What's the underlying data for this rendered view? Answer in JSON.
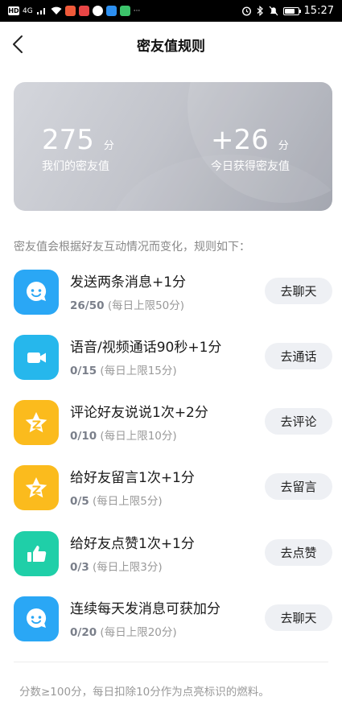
{
  "status_bar": {
    "left_chips": [
      "HD",
      "4G"
    ],
    "dots": "···",
    "time": "15:27",
    "battery_level": 0.75
  },
  "header": {
    "title": "密友值规则"
  },
  "card": {
    "score": "275",
    "score_unit": "分",
    "score_label": "我们的密友值",
    "today": "+26",
    "today_unit": "分",
    "today_label": "今日获得密友值"
  },
  "intro": "密友值会根据好友互动情况而变化，规则如下：",
  "rules": [
    {
      "title": "发送两条消息+1分",
      "progress": "26/50",
      "limit": "(每日上限50分)",
      "button": "去聊天",
      "icon": "chat-bubble-icon",
      "color": "#2aa7f5"
    },
    {
      "title": "语音/视频通话90秒+1分",
      "progress": "0/15",
      "limit": "(每日上限15分)",
      "button": "去通话",
      "icon": "video-camera-icon",
      "color": "#26b7ec"
    },
    {
      "title": "评论好友说说1次+2分",
      "progress": "0/10",
      "limit": "(每日上限10分)",
      "button": "去评论",
      "icon": "star-icon",
      "color": "#fbbb1d"
    },
    {
      "title": "给好友留言1次+1分",
      "progress": "0/5",
      "limit": "(每日上限5分)",
      "button": "去留言",
      "icon": "star-icon",
      "color": "#fbbb1d"
    },
    {
      "title": "给好友点赞1次+1分",
      "progress": "0/3",
      "limit": "(每日上限3分)",
      "button": "去点赞",
      "icon": "thumbs-up-icon",
      "color": "#1fcfa8"
    },
    {
      "title": "连续每天发消息可获加分",
      "progress": "0/20",
      "limit": "(每日上限20分)",
      "button": "去聊天",
      "icon": "chat-bubble-icon",
      "color": "#2aa7f5"
    }
  ],
  "footer": "分数≥100分，每日扣除10分作为点亮标识的燃料。"
}
